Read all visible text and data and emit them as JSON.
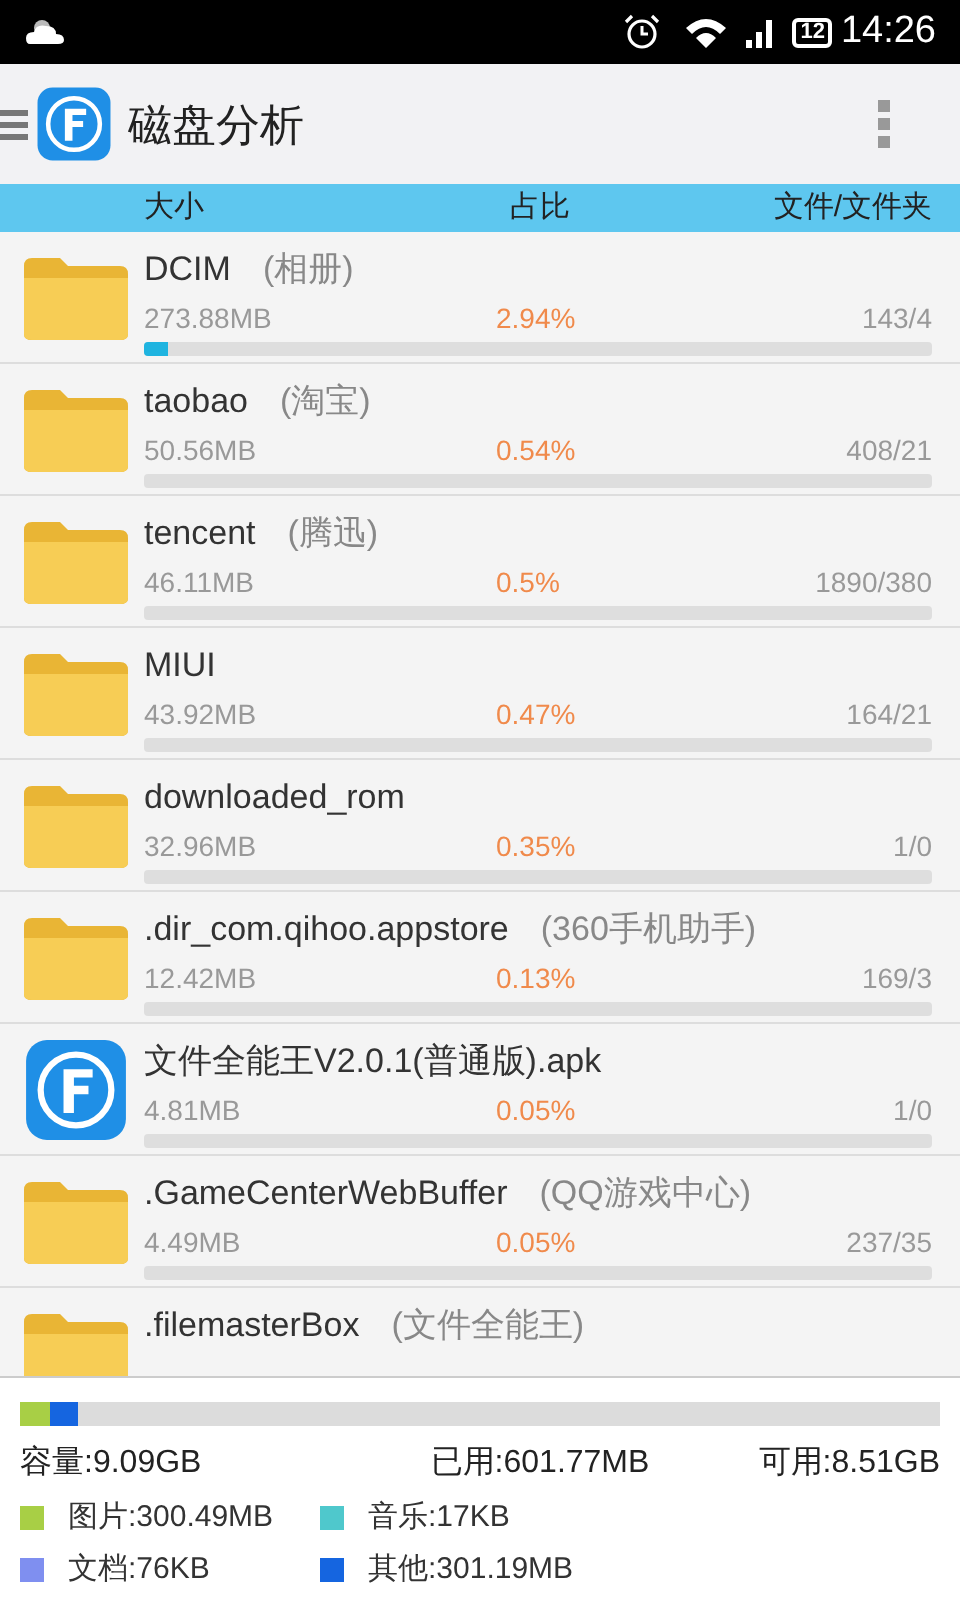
{
  "status_bar": {
    "time": "14:26",
    "battery": "12"
  },
  "toolbar": {
    "title": "磁盘分析"
  },
  "columns": [
    "大小",
    "占比",
    "文件/文件夹"
  ],
  "rows": [
    {
      "kind": "folder",
      "name": "DCIM",
      "alias": "(相册)",
      "size": "273.88MB",
      "percent": "2.94%",
      "count": "143/4",
      "level": 0.0294
    },
    {
      "kind": "folder",
      "name": "taobao",
      "alias": "(淘宝)",
      "size": "50.56MB",
      "percent": "0.54%",
      "count": "408/21"
    },
    {
      "kind": "folder",
      "name": "tencent",
      "alias": "(腾迅)",
      "size": "46.11MB",
      "percent": "0.5%",
      "count": "1890/380"
    },
    {
      "kind": "folder",
      "name": "MIUI",
      "size": "43.92MB",
      "percent": "0.47%",
      "count": "164/21"
    },
    {
      "kind": "folder",
      "name": "downloaded_rom",
      "size": "32.96MB",
      "percent": "0.35%",
      "count": "1/0"
    },
    {
      "kind": "folder",
      "name": ".dir_com.qihoo.appstore",
      "alias": "(360手机助手)",
      "size": "12.42MB",
      "percent": "0.13%",
      "count": "169/3"
    },
    {
      "kind": "app",
      "name": "文件全能王V2.0.1(普通版).apk",
      "size": "4.81MB",
      "percent": "0.05%",
      "count": "1/0"
    },
    {
      "kind": "folder",
      "name": ".GameCenterWebBuffer",
      "alias": "(QQ游戏中心)",
      "size": "4.49MB",
      "percent": "0.05%",
      "count": "237/35"
    },
    {
      "kind": "folder",
      "name": ".filemasterBox",
      "alias": "(文件全能王)"
    }
  ],
  "summary": {
    "capacity": "容量:9.09GB",
    "used": "已用:601.77MB",
    "free": "可用:8.51GB"
  },
  "legend": [
    {
      "label": "图片:300.49MB",
      "color": "#a8cf45",
      "level": 0.032
    },
    {
      "label": "音乐:17KB",
      "color": "#4fc8cc"
    },
    {
      "label": "文档:76KB",
      "color": "#7f8ff0"
    },
    {
      "label": "其他:301.19MB",
      "color": "#1565e0",
      "level": 0.032
    }
  ]
}
